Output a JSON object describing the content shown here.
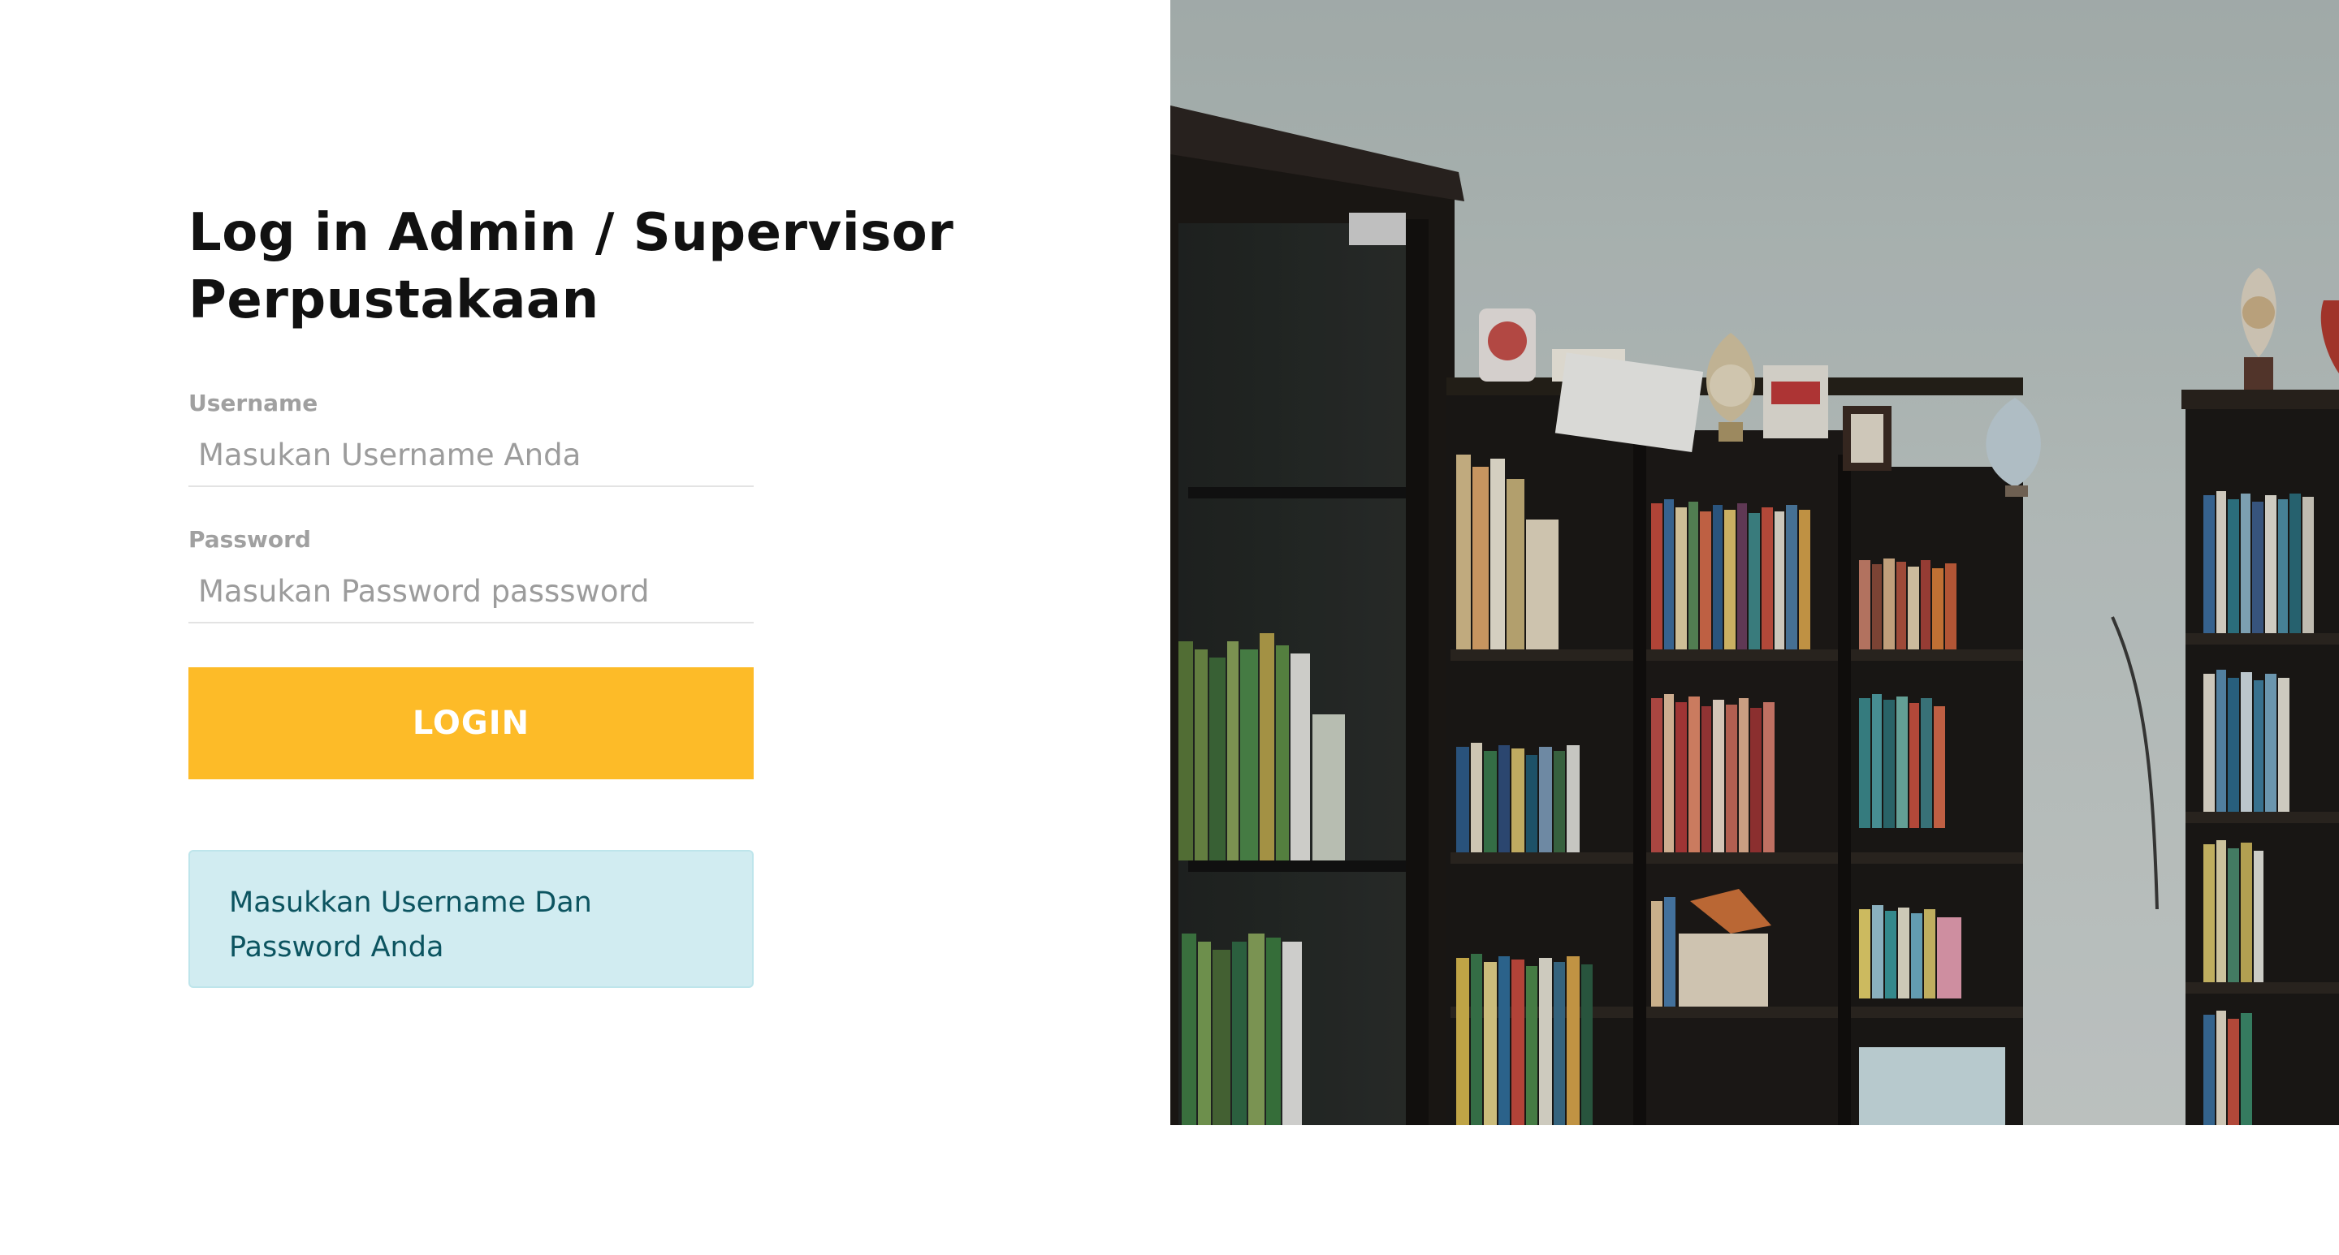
{
  "login": {
    "title": "Log in Admin / Supervisor Perpustakaan",
    "username_label": "Username",
    "username_placeholder": "Masukan Username Anda",
    "username_value": "",
    "password_label": "Password",
    "password_placeholder": "Masukan Password passsword",
    "password_value": "",
    "login_button_label": "LOGIN",
    "info_message": "Masukkan Username Dan Password Anda"
  },
  "hero_image": {
    "subject": "library-bookshelves-with-trophies"
  },
  "colors": {
    "accent": "#fdbb28",
    "info_background": "#d1ecf1",
    "info_text": "#0c5460",
    "label_text": "#a0a0a0",
    "title_text": "#111111"
  }
}
